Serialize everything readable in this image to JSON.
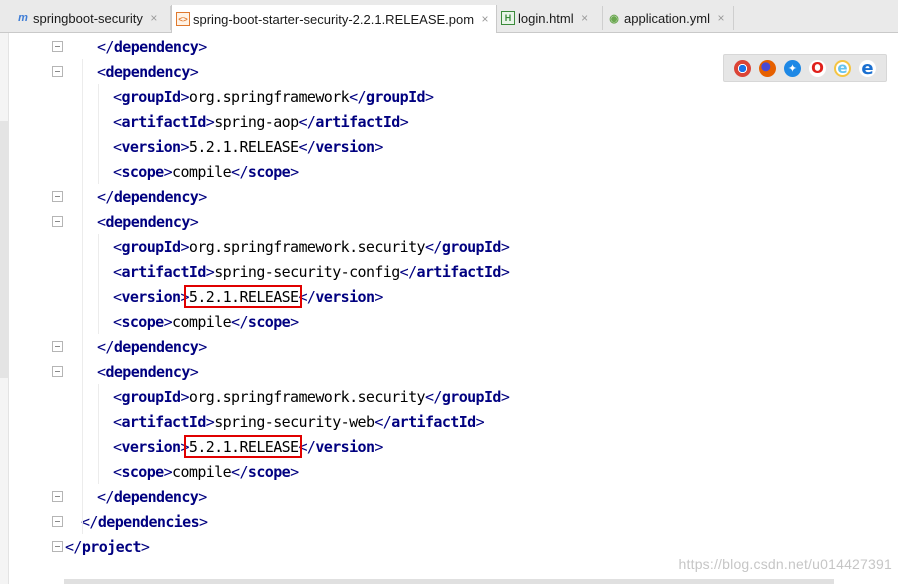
{
  "tabs": [
    {
      "label": "springboot-security",
      "icon": "maven-module-icon",
      "icon_glyph": "m",
      "icon_color": "#3f7dd6",
      "active": false
    },
    {
      "label": "spring-boot-starter-security-2.2.1.RELEASE.pom",
      "icon": "xml-file-icon",
      "icon_glyph": "<>",
      "icon_color": "#e0792d",
      "active": true
    },
    {
      "label": "login.html",
      "icon": "html-file-icon",
      "icon_glyph": "H",
      "icon_color": "#3a8a3a",
      "active": false
    },
    {
      "label": "application.yml",
      "icon": "spring-config-icon",
      "icon_glyph": "◉",
      "icon_color": "#6aa84f",
      "active": false
    }
  ],
  "close_glyph": "×",
  "code_lines": [
    {
      "tokens": [
        {
          "t": "br",
          "v": "</"
        },
        {
          "t": "tag",
          "v": "dependency"
        },
        {
          "t": "br",
          "v": ">"
        }
      ]
    },
    {
      "tokens": [
        {
          "t": "br",
          "v": "<"
        },
        {
          "t": "tag",
          "v": "dependency"
        },
        {
          "t": "br",
          "v": ">"
        }
      ]
    },
    {
      "tokens": [
        {
          "t": "br",
          "v": "<"
        },
        {
          "t": "tag",
          "v": "groupId"
        },
        {
          "t": "br",
          "v": ">"
        },
        {
          "t": "txt",
          "v": "org.springframework"
        },
        {
          "t": "br",
          "v": "</"
        },
        {
          "t": "tag",
          "v": "groupId"
        },
        {
          "t": "br",
          "v": ">"
        }
      ]
    },
    {
      "tokens": [
        {
          "t": "br",
          "v": "<"
        },
        {
          "t": "tag",
          "v": "artifactId"
        },
        {
          "t": "br",
          "v": ">"
        },
        {
          "t": "txt",
          "v": "spring-aop"
        },
        {
          "t": "br",
          "v": "</"
        },
        {
          "t": "tag",
          "v": "artifactId"
        },
        {
          "t": "br",
          "v": ">"
        }
      ]
    },
    {
      "tokens": [
        {
          "t": "br",
          "v": "<"
        },
        {
          "t": "tag",
          "v": "version"
        },
        {
          "t": "br",
          "v": ">"
        },
        {
          "t": "txt",
          "v": "5.2.1.RELEASE"
        },
        {
          "t": "br",
          "v": "</"
        },
        {
          "t": "tag",
          "v": "version"
        },
        {
          "t": "br",
          "v": ">"
        }
      ]
    },
    {
      "tokens": [
        {
          "t": "br",
          "v": "<"
        },
        {
          "t": "tag",
          "v": "scope"
        },
        {
          "t": "br",
          "v": ">"
        },
        {
          "t": "txt",
          "v": "compile"
        },
        {
          "t": "br",
          "v": "</"
        },
        {
          "t": "tag",
          "v": "scope"
        },
        {
          "t": "br",
          "v": ">"
        }
      ]
    },
    {
      "tokens": [
        {
          "t": "br",
          "v": "</"
        },
        {
          "t": "tag",
          "v": "dependency"
        },
        {
          "t": "br",
          "v": ">"
        }
      ]
    },
    {
      "tokens": [
        {
          "t": "br",
          "v": "<"
        },
        {
          "t": "tag",
          "v": "dependency"
        },
        {
          "t": "br",
          "v": ">"
        }
      ]
    },
    {
      "tokens": [
        {
          "t": "br",
          "v": "<"
        },
        {
          "t": "tag",
          "v": "groupId"
        },
        {
          "t": "br",
          "v": ">"
        },
        {
          "t": "txt",
          "v": "org.springframework.security"
        },
        {
          "t": "br",
          "v": "</"
        },
        {
          "t": "tag",
          "v": "groupId"
        },
        {
          "t": "br",
          "v": ">"
        }
      ]
    },
    {
      "tokens": [
        {
          "t": "br",
          "v": "<"
        },
        {
          "t": "tag",
          "v": "artifactId"
        },
        {
          "t": "br",
          "v": ">"
        },
        {
          "t": "txt",
          "v": "spring-security-config"
        },
        {
          "t": "br",
          "v": "</"
        },
        {
          "t": "tag",
          "v": "artifactId"
        },
        {
          "t": "br",
          "v": ">"
        }
      ]
    },
    {
      "tokens": [
        {
          "t": "br",
          "v": "<"
        },
        {
          "t": "tag",
          "v": "version"
        },
        {
          "t": "br",
          "v": ">"
        },
        {
          "t": "txt",
          "v": "5.2.1.RELEASE"
        },
        {
          "t": "br",
          "v": "</"
        },
        {
          "t": "tag",
          "v": "version"
        },
        {
          "t": "br",
          "v": ">"
        }
      ]
    },
    {
      "tokens": [
        {
          "t": "br",
          "v": "<"
        },
        {
          "t": "tag",
          "v": "scope"
        },
        {
          "t": "br",
          "v": ">"
        },
        {
          "t": "txt",
          "v": "compile"
        },
        {
          "t": "br",
          "v": "</"
        },
        {
          "t": "tag",
          "v": "scope"
        },
        {
          "t": "br",
          "v": ">"
        }
      ]
    },
    {
      "tokens": [
        {
          "t": "br",
          "v": "</"
        },
        {
          "t": "tag",
          "v": "dependency"
        },
        {
          "t": "br",
          "v": ">"
        }
      ]
    },
    {
      "tokens": [
        {
          "t": "br",
          "v": "<"
        },
        {
          "t": "tag",
          "v": "dependency"
        },
        {
          "t": "br",
          "v": ">"
        }
      ]
    },
    {
      "tokens": [
        {
          "t": "br",
          "v": "<"
        },
        {
          "t": "tag",
          "v": "groupId"
        },
        {
          "t": "br",
          "v": ">"
        },
        {
          "t": "txt",
          "v": "org.springframework.security"
        },
        {
          "t": "br",
          "v": "</"
        },
        {
          "t": "tag",
          "v": "groupId"
        },
        {
          "t": "br",
          "v": ">"
        }
      ]
    },
    {
      "tokens": [
        {
          "t": "br",
          "v": "<"
        },
        {
          "t": "tag",
          "v": "artifactId"
        },
        {
          "t": "br",
          "v": ">"
        },
        {
          "t": "txt",
          "v": "spring-security-web"
        },
        {
          "t": "br",
          "v": "</"
        },
        {
          "t": "tag",
          "v": "artifactId"
        },
        {
          "t": "br",
          "v": ">"
        }
      ]
    },
    {
      "tokens": [
        {
          "t": "br",
          "v": "<"
        },
        {
          "t": "tag",
          "v": "version"
        },
        {
          "t": "br",
          "v": ">"
        },
        {
          "t": "txt",
          "v": "5.2.1.RELEASE"
        },
        {
          "t": "br",
          "v": "</"
        },
        {
          "t": "tag",
          "v": "version"
        },
        {
          "t": "br",
          "v": ">"
        }
      ]
    },
    {
      "tokens": [
        {
          "t": "br",
          "v": "<"
        },
        {
          "t": "tag",
          "v": "scope"
        },
        {
          "t": "br",
          "v": ">"
        },
        {
          "t": "txt",
          "v": "compile"
        },
        {
          "t": "br",
          "v": "</"
        },
        {
          "t": "tag",
          "v": "scope"
        },
        {
          "t": "br",
          "v": ">"
        }
      ]
    },
    {
      "tokens": [
        {
          "t": "br",
          "v": "</"
        },
        {
          "t": "tag",
          "v": "dependency"
        },
        {
          "t": "br",
          "v": ">"
        }
      ]
    },
    {
      "tokens": [
        {
          "t": "br",
          "v": "</"
        },
        {
          "t": "tag",
          "v": "dependencies"
        },
        {
          "t": "br",
          "v": ">"
        }
      ]
    },
    {
      "tokens": [
        {
          "t": "br",
          "v": "</"
        },
        {
          "t": "tag",
          "v": "project"
        },
        {
          "t": "br",
          "v": ">"
        }
      ]
    }
  ],
  "browsers": [
    {
      "name": "chrome-icon",
      "glyph": "●",
      "color": "#db4437"
    },
    {
      "name": "firefox-icon",
      "glyph": "●",
      "color": "#e66000"
    },
    {
      "name": "safari-icon",
      "glyph": "✦",
      "color": "#1e88e5"
    },
    {
      "name": "opera-icon",
      "glyph": "O",
      "color": "#e0201b"
    },
    {
      "name": "ie-icon",
      "glyph": "e",
      "color": "#66c3ee"
    },
    {
      "name": "edge-icon",
      "glyph": "e",
      "color": "#1a6fd0"
    }
  ],
  "watermark": "https://blog.csdn.net/u014427391",
  "colors": {
    "tag": "#000080",
    "text": "#000000",
    "highlight_box": "#e00000"
  }
}
